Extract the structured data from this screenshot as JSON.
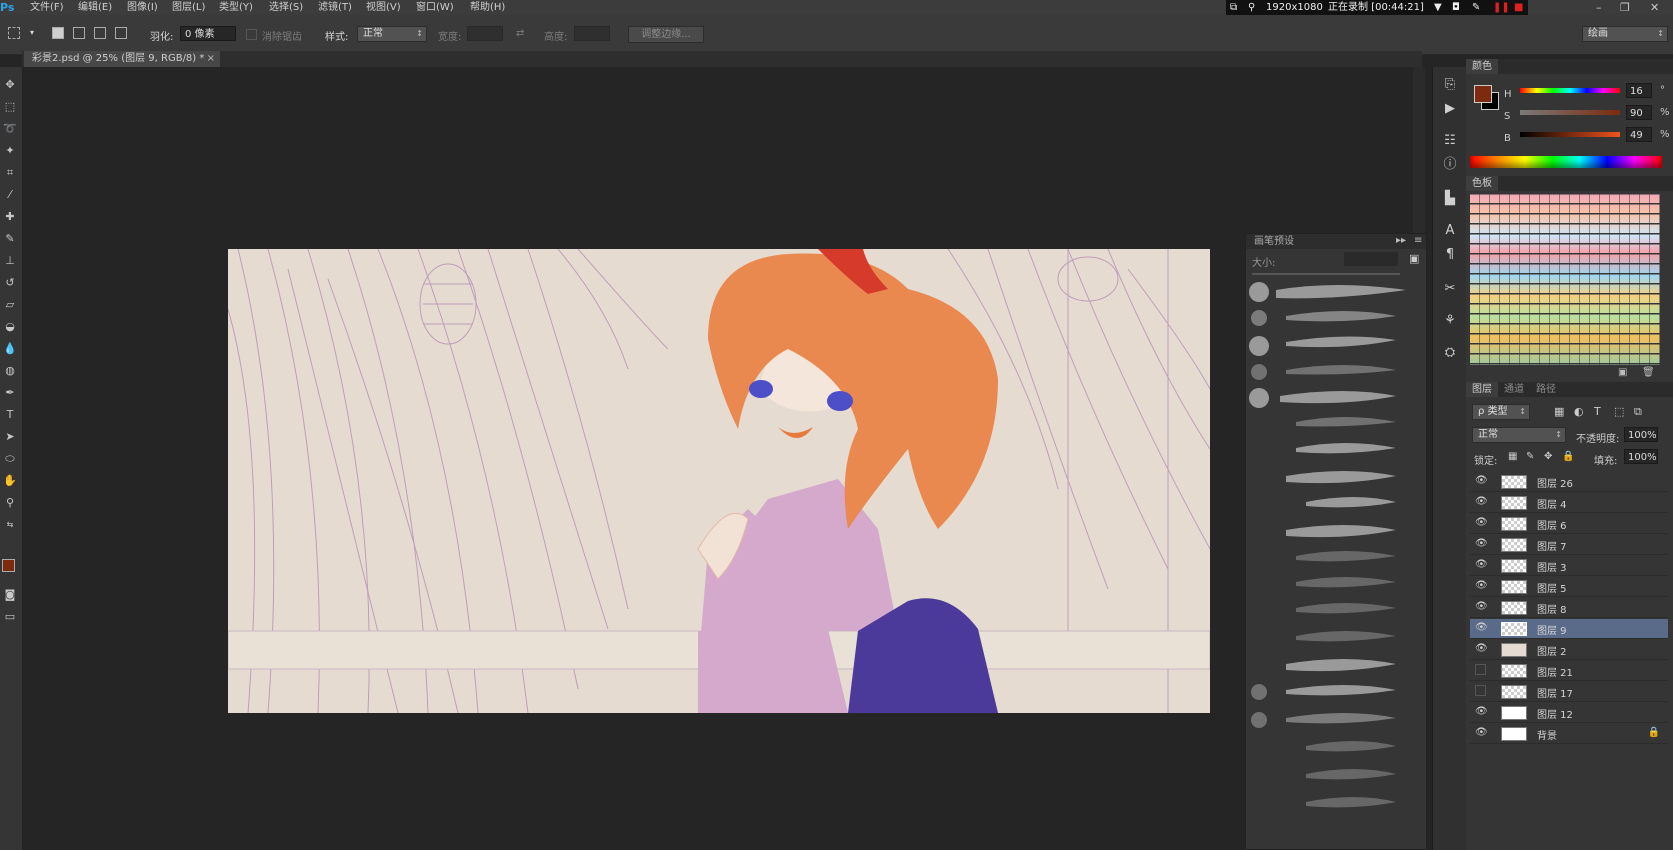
{
  "menubar": {
    "logo": "Ps",
    "items": [
      "文件(F)",
      "编辑(E)",
      "图像(I)",
      "图层(L)",
      "类型(Y)",
      "选择(S)",
      "滤镜(T)",
      "视图(V)",
      "窗口(W)",
      "帮助(H)"
    ]
  },
  "recorder": {
    "resolution": "1920x1080",
    "status": "正在录制 [00:44:21]"
  },
  "options": {
    "feather_label": "羽化:",
    "feather_value": "0 像素",
    "antialias_label": "消除锯齿",
    "style_label": "样式:",
    "style_value": "正常",
    "width_label": "宽度:",
    "height_label": "高度:",
    "refine_edge_label": "调整边缘...",
    "workspace": "绘画"
  },
  "document": {
    "tab_title": "彩景2.psd @ 25% (图层 9, RGB/8) *",
    "close": "×"
  },
  "brush_panel": {
    "title": "画笔预设",
    "size_label": "大小:"
  },
  "color_panel": {
    "tab": "颜色",
    "h_label": "H",
    "h_value": "16",
    "s_label": "S",
    "s_value": "90",
    "b_label": "B",
    "b_value": "49",
    "degree": "°",
    "percent": "%",
    "foreground": "#7d2a0e",
    "background": "#000000"
  },
  "swatches_panel": {
    "tab": "色板"
  },
  "layers_panel": {
    "tabs": [
      "图层",
      "通道",
      "路径"
    ],
    "filter_label": "ρ 类型",
    "blend_mode": "正常",
    "opacity_label": "不透明度:",
    "opacity_value": "100%",
    "lock_label": "锁定:",
    "fill_label": "填充:",
    "fill_value": "100%",
    "layers": [
      {
        "name": "图层 26",
        "visible": true,
        "selected": false
      },
      {
        "name": "图层 4",
        "visible": true,
        "selected": false
      },
      {
        "name": "图层 6",
        "visible": true,
        "selected": false
      },
      {
        "name": "图层 7",
        "visible": true,
        "selected": false
      },
      {
        "name": "图层 3",
        "visible": true,
        "selected": false
      },
      {
        "name": "图层 5",
        "visible": true,
        "selected": false
      },
      {
        "name": "图层 8",
        "visible": true,
        "selected": false
      },
      {
        "name": "图层 9",
        "visible": true,
        "selected": true
      },
      {
        "name": "图层 2",
        "visible": true,
        "selected": false
      },
      {
        "name": "图层 21",
        "visible": false,
        "selected": false
      },
      {
        "name": "图层 17",
        "visible": false,
        "selected": false
      },
      {
        "name": "图层 12",
        "visible": true,
        "selected": false
      },
      {
        "name": "背景",
        "visible": true,
        "selected": false
      }
    ]
  },
  "colors": {
    "selected_layer": "#5a6b89",
    "hair": "#e9894f",
    "kimono": "#d4a9cc",
    "obi": "#4b3a9a",
    "eyes": "#4d4fc9"
  }
}
